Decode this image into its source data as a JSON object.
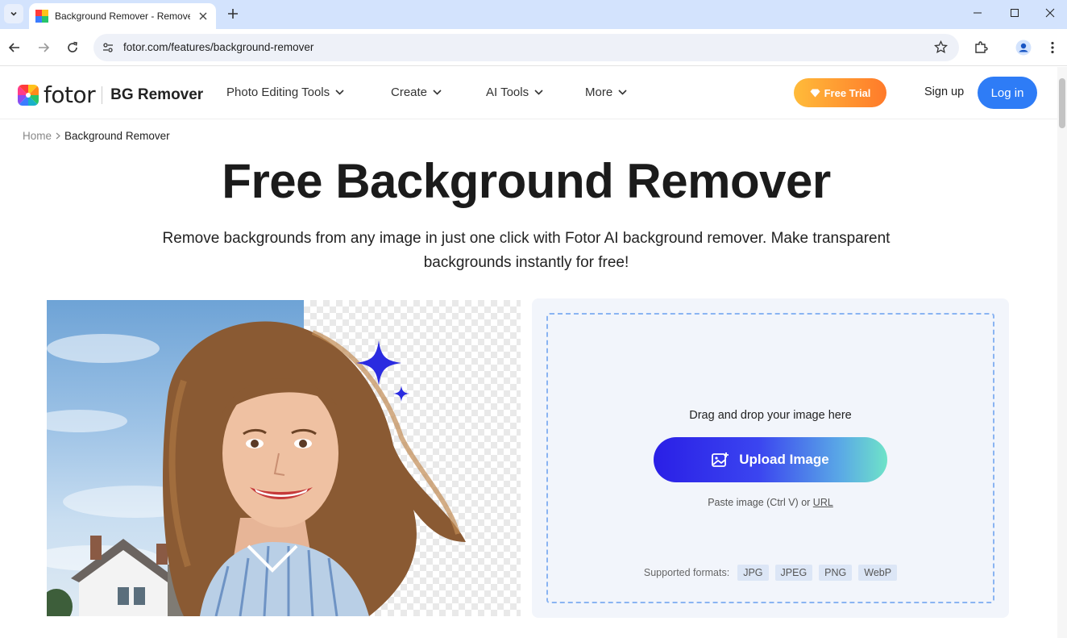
{
  "browser": {
    "tab_title": "Background Remover - Remove",
    "url": "fotor.com/features/background-remover"
  },
  "header": {
    "logo_text": "fotor",
    "product_name": "BG Remover",
    "menu": [
      "Photo Editing Tools",
      "Create",
      "AI Tools",
      "More"
    ],
    "free_trial": "Free Trial",
    "sign_up": "Sign up",
    "log_in": "Log in"
  },
  "breadcrumb": {
    "home": "Home",
    "current": "Background Remover"
  },
  "hero": {
    "title": "Free Background Remover",
    "subtitle": "Remove backgrounds from any image in just one click with Fotor AI background remover. Make transparent backgrounds instantly for free!"
  },
  "upload": {
    "drag_text": "Drag and drop your image here",
    "button_label": "Upload Image",
    "paste_text": "Paste image (Ctrl V) or",
    "url_link": "URL",
    "formats_label": "Supported formats:",
    "formats": [
      "JPG",
      "JPEG",
      "PNG",
      "WebP"
    ]
  },
  "colors": {
    "accent": "#2e7cf6",
    "upload_start": "#2a1fe6",
    "upload_end": "#6fe3c8",
    "trial_start": "#ffbb3a",
    "trial_end": "#ff7a2a",
    "sparkle": "#2a2be0"
  }
}
